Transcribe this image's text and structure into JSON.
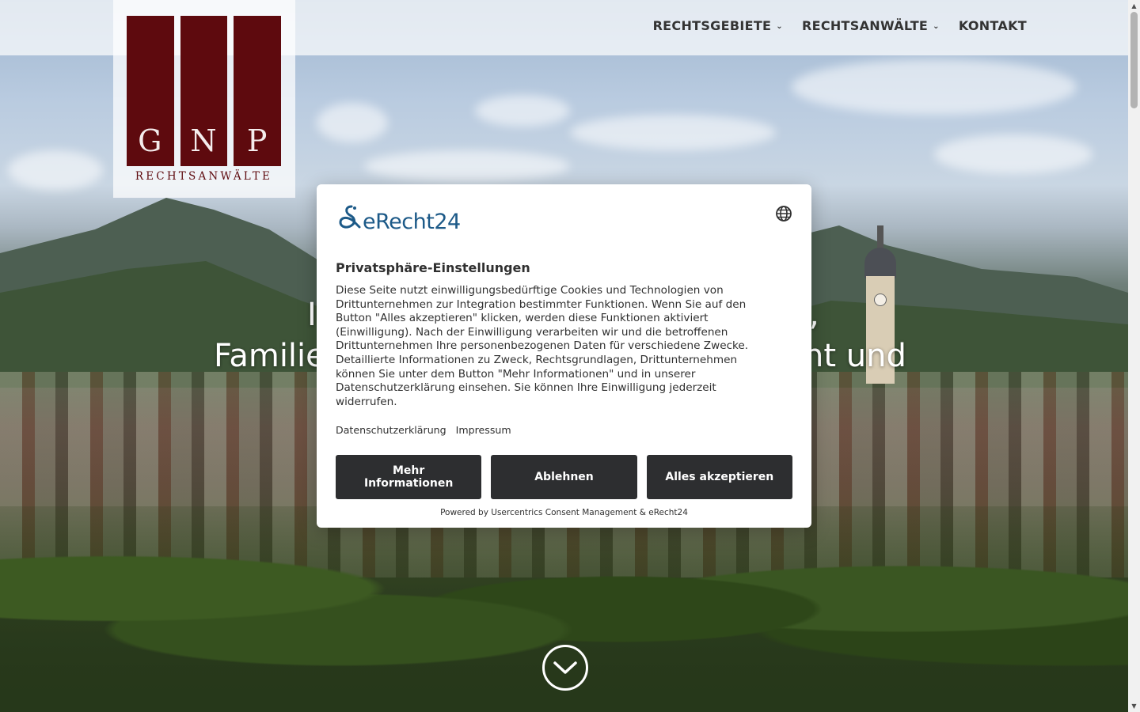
{
  "site": {
    "logo": {
      "letters": [
        "G",
        "N",
        "P"
      ],
      "subtitle": "RECHTSANWÄLTE",
      "bar_color": "#5e0a0e"
    },
    "nav": [
      {
        "label": "RECHTSGEBIETE",
        "has_dropdown": true
      },
      {
        "label": "RECHTSANWÄLTE",
        "has_dropdown": true
      },
      {
        "label": "KONTAKT",
        "has_dropdown": false
      }
    ],
    "hero": {
      "line1_left": "I",
      "line1_right": ",",
      "line2_left": "Familie",
      "line2_right": "ht und"
    },
    "scroll_icon": "chevron-down-circle-icon"
  },
  "consent": {
    "brand": "eRecht24",
    "brand_color": "#1d5a88",
    "language_icon": "globe-icon",
    "title": "Privatsphäre-Einstellungen",
    "text": "Diese Seite nutzt einwilligungsbedürftige Cookies und Technologien von Drittunternehmen zur Integration bestimmter Funktionen. Wenn Sie auf den Button \"Alles akzeptieren\" klicken, werden diese Funktionen aktiviert (Einwilligung). Nach der Einwilligung verarbeiten wir und die betroffenen Drittunternehmen Ihre personenbezogenen Daten für verschiedene Zwecke. Detaillierte Informationen zu Zweck, Rechtsgrundlagen, Drittunternehmen können Sie unter dem Button \"Mehr Informationen\" und in unserer Datenschutzerklärung einsehen. Sie können Ihre Einwilligung jederzeit widerrufen.",
    "links": {
      "privacy": "Datenschutzerklärung",
      "imprint": "Impressum"
    },
    "buttons": {
      "more_info": "Mehr Informationen",
      "deny": "Ablehnen",
      "accept_all": "Alles akzeptieren"
    },
    "button_color": "#2d2e30",
    "powered_by": "Powered by Usercentrics Consent Management & eRecht24"
  }
}
